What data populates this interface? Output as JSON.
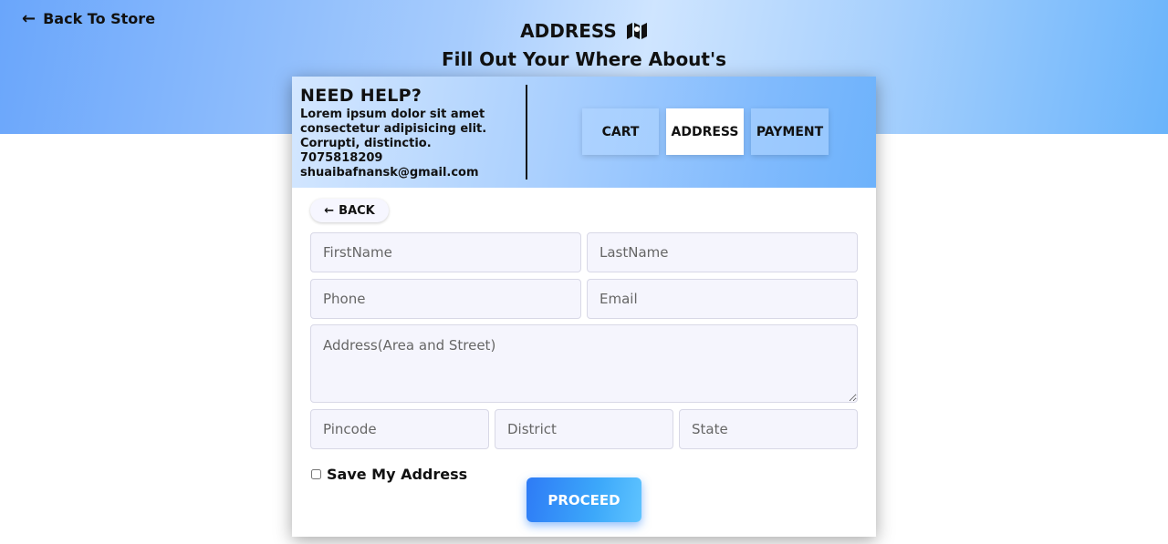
{
  "header": {
    "back_to_store": "Back To Store",
    "title": "ADDRESS",
    "title_icon": "map-icon",
    "subtitle": "Fill Out Your Where About's"
  },
  "help": {
    "heading": "NEED HELP?",
    "lines": [
      "Lorem ipsum dolor sit amet",
      "consectetur adipisicing elit.",
      "Corrupti, distinctio.",
      "7075818209",
      "shuaibafnansk@gmail.com"
    ]
  },
  "steps": [
    {
      "label": "CART",
      "active": false
    },
    {
      "label": "ADDRESS",
      "active": true
    },
    {
      "label": "PAYMENT",
      "active": false
    }
  ],
  "form": {
    "back_label": "BACK",
    "first_name": {
      "placeholder": "FirstName",
      "value": ""
    },
    "last_name": {
      "placeholder": "LastName",
      "value": ""
    },
    "phone": {
      "placeholder": "Phone",
      "value": ""
    },
    "email": {
      "placeholder": "Email",
      "value": ""
    },
    "address": {
      "placeholder": "Address(Area and Street)",
      "value": ""
    },
    "pincode": {
      "placeholder": "Pincode",
      "value": ""
    },
    "district": {
      "placeholder": "District",
      "value": ""
    },
    "state": {
      "placeholder": "State",
      "value": ""
    },
    "save_label": "Save My Address",
    "save_checked": false,
    "proceed_label": "PROCEED"
  },
  "colors": {
    "accent": "#2e7bf6",
    "header_gradient_start": "#6aa6fb",
    "header_gradient_end": "#6ab4fb"
  }
}
